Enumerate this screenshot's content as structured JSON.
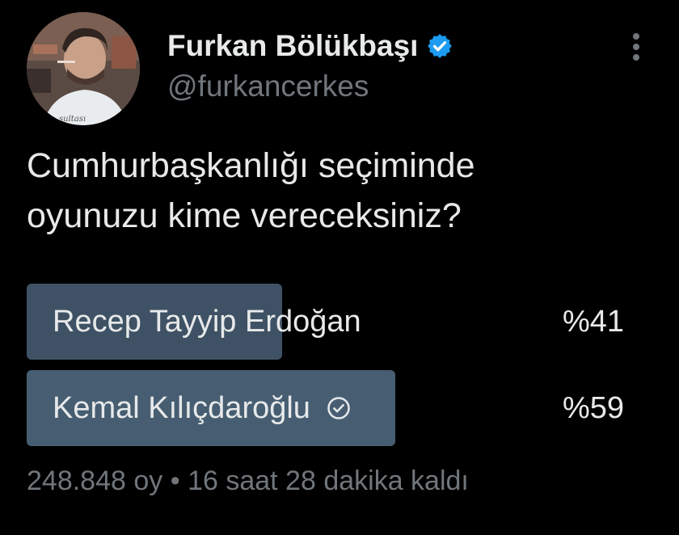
{
  "tweet": {
    "author": {
      "display_name": "Furkan Bölükbaşı",
      "handle": "@furkancerkes",
      "verified_icon": "verified-badge-icon",
      "avatar_icon": "avatar-photo"
    },
    "more_icon": "more-vertical-icon",
    "text_line_1": "Cumhurbaşkanlığı seçiminde",
    "text_line_2": "oyunuzu kime vereceksiniz?"
  },
  "poll": {
    "options": [
      {
        "label": "Recep Tayyip Erdoğan",
        "percent_text": "%41",
        "percent": 41,
        "selected": false
      },
      {
        "label": "Kemal Kılıçdaroğlu",
        "percent_text": "%59",
        "percent": 59,
        "selected": true
      }
    ],
    "votes": "248.848 oy",
    "separator": "•",
    "time_left": "16 saat 28 dakika kaldı"
  },
  "colors": {
    "background": "#000000",
    "text_primary": "#e7e9ea",
    "text_secondary": "#71767b",
    "poll_bar": "#3f5265",
    "poll_bar_winner": "#475e72",
    "verified_blue": "#1d9bf0"
  }
}
